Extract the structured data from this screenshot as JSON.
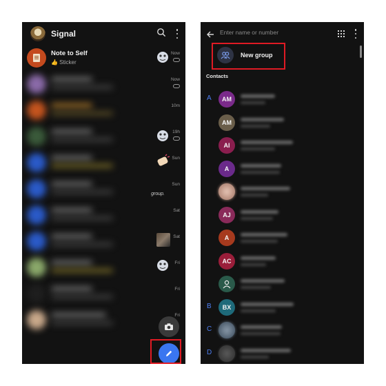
{
  "left": {
    "app_title": "Signal",
    "note_to_self": {
      "name": "Note to Self",
      "preview": "👍 Sticker",
      "time": "Now"
    },
    "chat_times": [
      "Now",
      "10m",
      "19h",
      "Sun",
      "Sun",
      "Sat",
      "Sat",
      "Fri",
      "Fri",
      "Fri"
    ],
    "group_preview_tail": "group.",
    "icons": {
      "search": "search-icon",
      "menu": "more-vert-icon",
      "camera": "camera-icon",
      "compose": "pencil-icon"
    }
  },
  "right": {
    "search_placeholder": "Enter name or number",
    "new_group_label": "New group",
    "contacts_header": "Contacts",
    "contacts": [
      {
        "letter": "A",
        "initials": "AM",
        "color": "#7a2a8a"
      },
      {
        "letter": "",
        "initials": "AM",
        "color": "#6a5e4a"
      },
      {
        "letter": "",
        "initials": "AI",
        "color": "#8a1e4e"
      },
      {
        "letter": "",
        "initials": "A",
        "color": "#6a2a8a"
      },
      {
        "letter": "",
        "initials": "",
        "color": "#b08a7a"
      },
      {
        "letter": "",
        "initials": "AJ",
        "color": "#8a2a5a"
      },
      {
        "letter": "",
        "initials": "A",
        "color": "#a63a1e"
      },
      {
        "letter": "",
        "initials": "AC",
        "color": "#9a1e3a"
      },
      {
        "letter": "",
        "initials": "",
        "color": "#2a5a4a"
      },
      {
        "letter": "B",
        "initials": "BX",
        "color": "#1e6a7a"
      },
      {
        "letter": "C",
        "initials": "",
        "color": "#4a5a6a"
      },
      {
        "letter": "D",
        "initials": "",
        "color": "#3a3a3a"
      }
    ]
  },
  "colors": {
    "background": "#121212",
    "accent": "#3a76f0",
    "highlight": "#e01b24",
    "section_letter": "#4d7ef2"
  }
}
